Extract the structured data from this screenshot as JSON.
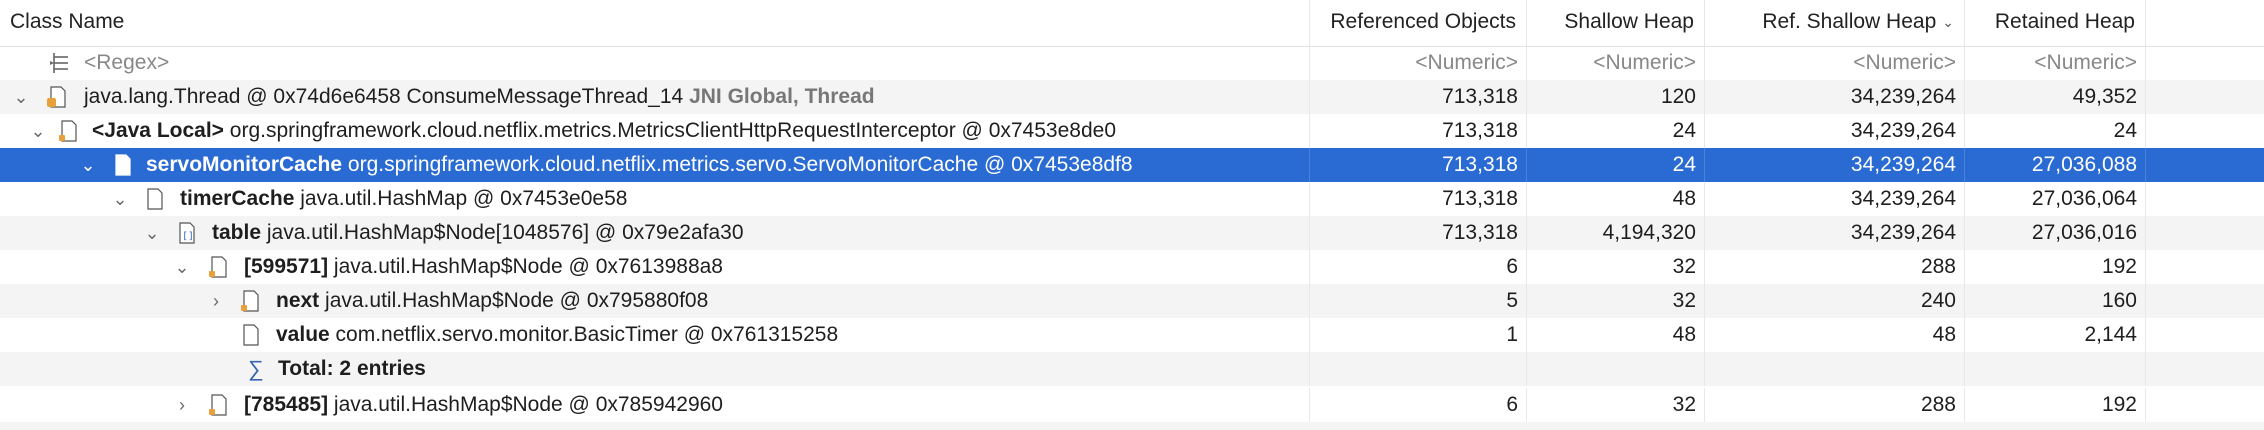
{
  "columns": {
    "class_name": "Class Name",
    "referenced_objects": "Referenced Objects",
    "shallow_heap": "Shallow Heap",
    "ref_shallow_heap": "Ref. Shallow Heap",
    "retained_heap": "Retained Heap"
  },
  "filter_row": {
    "regex": "<Regex>",
    "numeric": "<Numeric>"
  },
  "rows": [
    {
      "prefix": "",
      "name": "java.lang.Thread @ 0x74d6e6458  ConsumeMessageThread_14",
      "suffix": "JNI Global, Thread",
      "ref": "713,318",
      "shallow": "120",
      "refshallow": "34,239,264",
      "retained": "49,352"
    },
    {
      "prefix": "<Java Local>",
      "name": "org.springframework.cloud.netflix.metrics.MetricsClientHttpRequestInterceptor @ 0x7453e8de0",
      "suffix": "",
      "ref": "713,318",
      "shallow": "24",
      "refshallow": "34,239,264",
      "retained": "24"
    },
    {
      "prefix": "servoMonitorCache",
      "name": "org.springframework.cloud.netflix.metrics.servo.ServoMonitorCache @ 0x7453e8df8",
      "suffix": "",
      "ref": "713,318",
      "shallow": "24",
      "refshallow": "34,239,264",
      "retained": "27,036,088"
    },
    {
      "prefix": "timerCache",
      "name": "java.util.HashMap @ 0x7453e0e58",
      "suffix": "",
      "ref": "713,318",
      "shallow": "48",
      "refshallow": "34,239,264",
      "retained": "27,036,064"
    },
    {
      "prefix": "table",
      "name": "java.util.HashMap$Node[1048576] @ 0x79e2afa30",
      "suffix": "",
      "ref": "713,318",
      "shallow": "4,194,320",
      "refshallow": "34,239,264",
      "retained": "27,036,016"
    },
    {
      "prefix": "[599571]",
      "name": "java.util.HashMap$Node @ 0x7613988a8",
      "suffix": "",
      "ref": "6",
      "shallow": "32",
      "refshallow": "288",
      "retained": "192"
    },
    {
      "prefix": "next",
      "name": "java.util.HashMap$Node @ 0x795880f08",
      "suffix": "",
      "ref": "5",
      "shallow": "32",
      "refshallow": "240",
      "retained": "160"
    },
    {
      "prefix": "value",
      "name": "com.netflix.servo.monitor.BasicTimer @ 0x761315258",
      "suffix": "",
      "ref": "1",
      "shallow": "48",
      "refshallow": "48",
      "retained": "2,144"
    },
    {
      "prefix": "Total: 2 entries",
      "name": "",
      "suffix": "",
      "ref": "",
      "shallow": "",
      "refshallow": "",
      "retained": ""
    },
    {
      "prefix": "[785485]",
      "name": "java.util.HashMap$Node @ 0x785942960",
      "suffix": "",
      "ref": "6",
      "shallow": "32",
      "refshallow": "288",
      "retained": "192"
    }
  ],
  "colors": {
    "selection": "#2a6bd3",
    "alt_row": "#f4f4f4",
    "icon_orange": "#e8a13a"
  }
}
